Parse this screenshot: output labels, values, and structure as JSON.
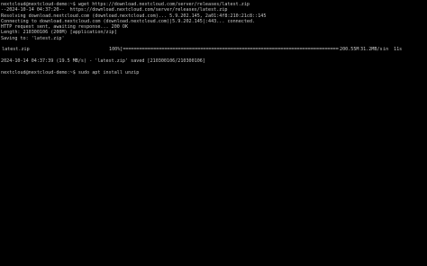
{
  "terminal": {
    "lines_top": [
      "nextcloud@nextcloud-demo:~$ wget https://download.nextcloud.com/server/releases/latest.zip",
      "--2024-10-14 04:37:20--  https://download.nextcloud.com/server/releases/latest.zip",
      "Resolving download.nextcloud.com (download.nextcloud.com)... 5.9.202.145, 2a01:4f8:210:21c8::145",
      "Connecting to download.nextcloud.com (download.nextcloud.com)|5.9.202.145|:443... connected.",
      "HTTP request sent, awaiting response... 200 OK",
      "Length: 210300106 (200M) [application/zip]",
      "Saving to: 'latest.zip'"
    ],
    "progress": {
      "file": "latest.zip",
      "bar": "100%[===========================================================================================>]",
      "size": "200.55M",
      "rate": "31.2MB/s",
      "in_label": "in",
      "time": "11s"
    },
    "saved_line": "2024-10-14 04:37:39 (19.5 MB/s) - 'latest.zip' saved [210300106/210300106]",
    "command_line": "nextcloud@nextcloud-demo:~$ sudo apt install unzip"
  }
}
